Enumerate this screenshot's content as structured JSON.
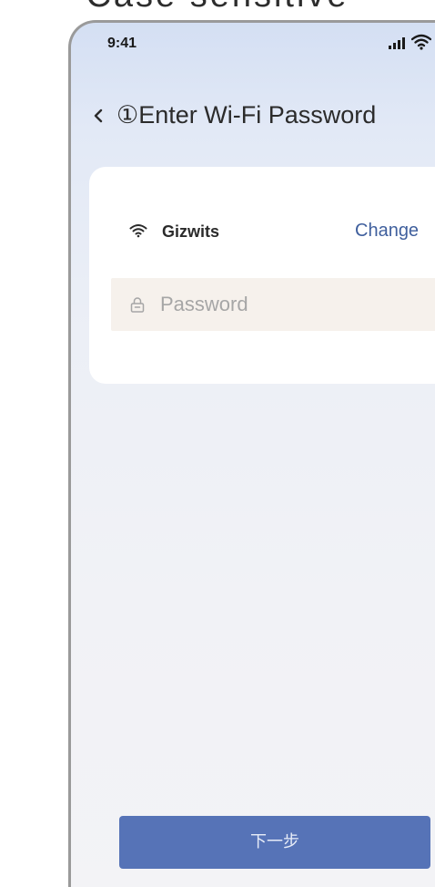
{
  "caption": {
    "text": "Case sensitive"
  },
  "status_bar": {
    "time": "9:41",
    "signal_icon": "cellular-signal-icon",
    "wifi_icon": "wifi-icon"
  },
  "header": {
    "back_icon": "chevron-left-icon",
    "title": "①Enter Wi-Fi Password"
  },
  "network": {
    "icon": "wifi-icon",
    "ssid": "Gizwits",
    "change_label": "Change"
  },
  "password": {
    "icon": "lock-icon",
    "placeholder": "Password",
    "value": ""
  },
  "footer": {
    "next_label": "下一步"
  },
  "colors": {
    "accent": "#5673b7",
    "link": "#3f5f9d",
    "field_background": "#f6f1ec"
  }
}
